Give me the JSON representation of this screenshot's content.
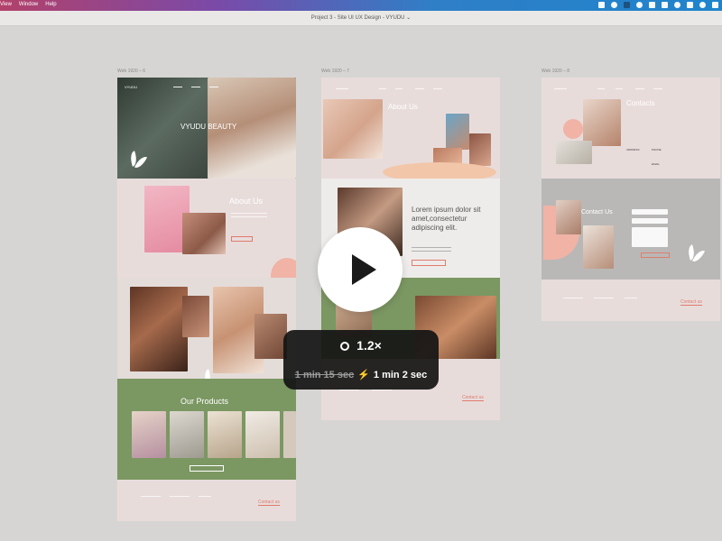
{
  "menubar": {
    "items": [
      "View",
      "Window",
      "Help"
    ]
  },
  "window": {
    "title": "Project 3 - Site UI UX Design - VYUDU"
  },
  "frames": [
    {
      "label": "Web 1920 – 6"
    },
    {
      "label": "Web 1920 – 7"
    },
    {
      "label": "Web 1920 – 8"
    }
  ],
  "frame1": {
    "brand": "VYUDU",
    "hero_title": "VYUDU BEAUTY",
    "about_title": "About Us",
    "products_title": "Our Products",
    "footer_cta": "Contact us"
  },
  "frame2": {
    "about_title": "About Us",
    "lorem_heading": "Lorem ipsum dolor sit amet,consectetur adipiscing elit.",
    "footer_cta": "Contact us"
  },
  "frame3": {
    "contacts_title": "Contacts",
    "address_label": "ADDRESS",
    "phone_label": "PHONE",
    "email_label": "EMAIL",
    "contact_form_title": "Contact Us",
    "footer_cta": "Contact us"
  },
  "player": {
    "speed": "1.2×",
    "original_time": "1 min 15 sec",
    "new_time": "1 min 2 sec"
  },
  "colors": {
    "accent": "#e07b6d",
    "green": "#7b9762",
    "pink": "#e8dcdb",
    "grey": "#b9b8b6"
  },
  "icons": [
    "dropbox-icon",
    "wifi-icon",
    "battery-icon",
    "control-center-icon",
    "moon-icon",
    "gauge-icon",
    "bolt-icon",
    "play-icon",
    "leaf-logo-icon"
  ]
}
